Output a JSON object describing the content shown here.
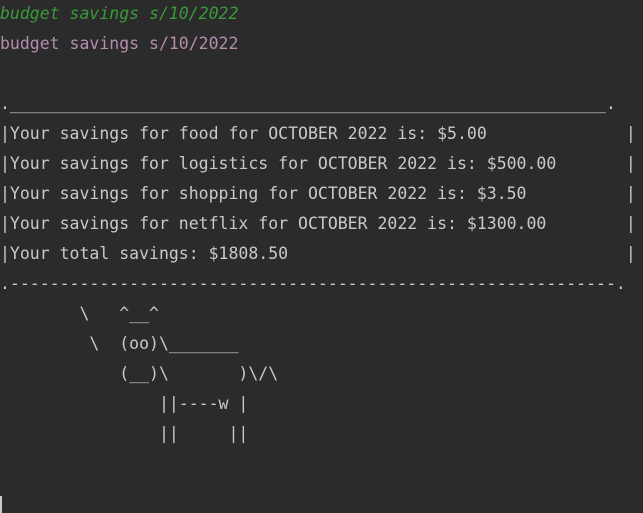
{
  "terminal": {
    "command_echo": "budget savings s/10/2022",
    "command_input": "budget savings s/10/2022",
    "box": {
      "border_top": ".____________________________________________________________.",
      "rows": [
        "|Your savings for food for OCTOBER 2022 is: $5.00              |",
        "|Your savings for logistics for OCTOBER 2022 is: $500.00       |",
        "|Your savings for shopping for OCTOBER 2022 is: $3.50          |",
        "|Your savings for netflix for OCTOBER 2022 is: $1300.00        |",
        "|Your total savings: $1808.50                                  |"
      ],
      "border_bottom": ".-------------------------------------------------------------."
    },
    "cow": [
      "        \\   ^__^",
      "         \\  (oo)\\_______",
      "            (__)\\       )\\/\\",
      "                ||----w |",
      "                ||     ||"
    ]
  },
  "colors": {
    "background": "#2b2b2b",
    "text": "#c9c9c9",
    "echo": "#3a9a3a",
    "input": "#b48ead"
  }
}
